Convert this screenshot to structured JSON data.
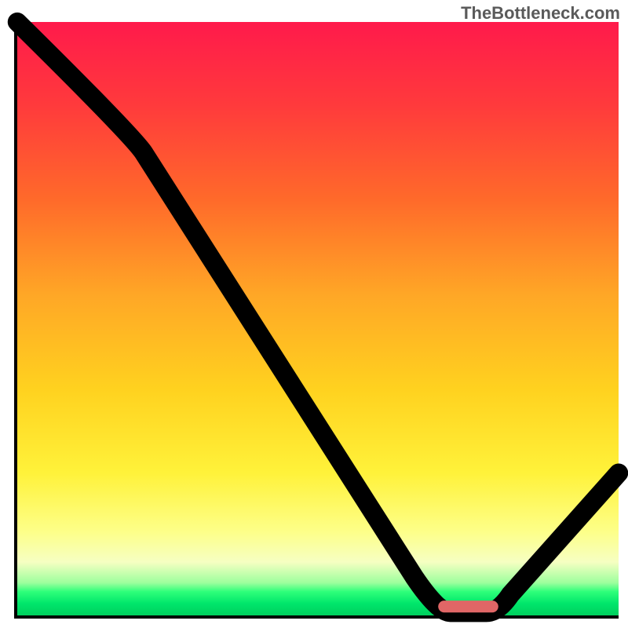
{
  "watermark": "TheBottleneck.com",
  "chart_data": {
    "type": "line",
    "title": "",
    "xlabel": "",
    "ylabel": "",
    "xlim": [
      0,
      100
    ],
    "ylim": [
      0,
      100
    ],
    "grid": false,
    "series": [
      {
        "name": "bottleneck-curve",
        "x": [
          0,
          21,
          72,
          78,
          100
        ],
        "values": [
          100,
          78,
          0.5,
          0.5,
          24
        ]
      }
    ],
    "annotations": [
      {
        "name": "optimal-zone-marker",
        "x_start": 70,
        "x_end": 80,
        "y": 1.5
      }
    ],
    "background_gradient": {
      "direction": "vertical",
      "stops": [
        {
          "pos": 0,
          "color": "#ff1a4b"
        },
        {
          "pos": 0.46,
          "color": "#ffa726"
        },
        {
          "pos": 0.76,
          "color": "#fff23a"
        },
        {
          "pos": 0.96,
          "color": "#2eff7a"
        },
        {
          "pos": 1.0,
          "color": "#00cf5e"
        }
      ]
    }
  }
}
